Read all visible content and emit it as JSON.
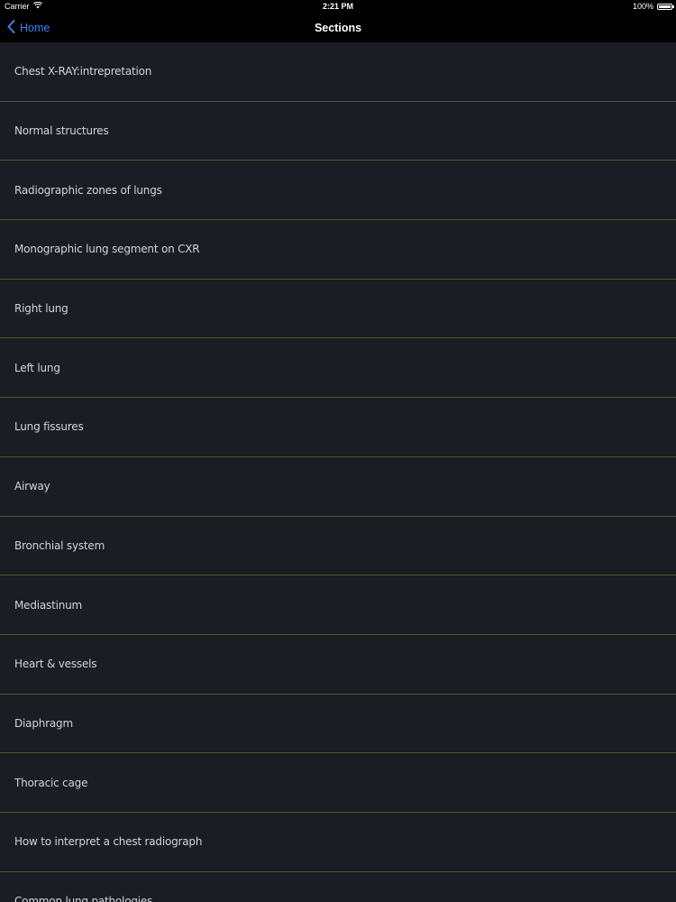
{
  "status_bar": {
    "carrier": "Carrier",
    "time": "2:21 PM",
    "battery": "100%",
    "battery_level": 1.0
  },
  "nav": {
    "back_label": "Home",
    "title": "Sections"
  },
  "sections": [
    "Chest X-RAY:intrepretation",
    "Normal structures",
    "Radiographic zones of lungs",
    "Monographic lung segment on CXR",
    "Right lung",
    "Left lung",
    "Lung fissures",
    "Airway",
    "Bronchial system",
    "Mediastinum",
    "Heart & vessels",
    "Diaphragm",
    "Thoracic cage",
    "How to interpret a chest radiograph",
    "Common lung pathologies"
  ],
  "colors": {
    "background": "#1b1c24",
    "bar": "#000000",
    "accent": "#3b82f6",
    "separator": "#4d5a2f",
    "text": "#d4d4d8"
  },
  "icons": {
    "wifi": "wifi-icon",
    "battery": "battery-icon",
    "back": "chevron-left-icon"
  }
}
